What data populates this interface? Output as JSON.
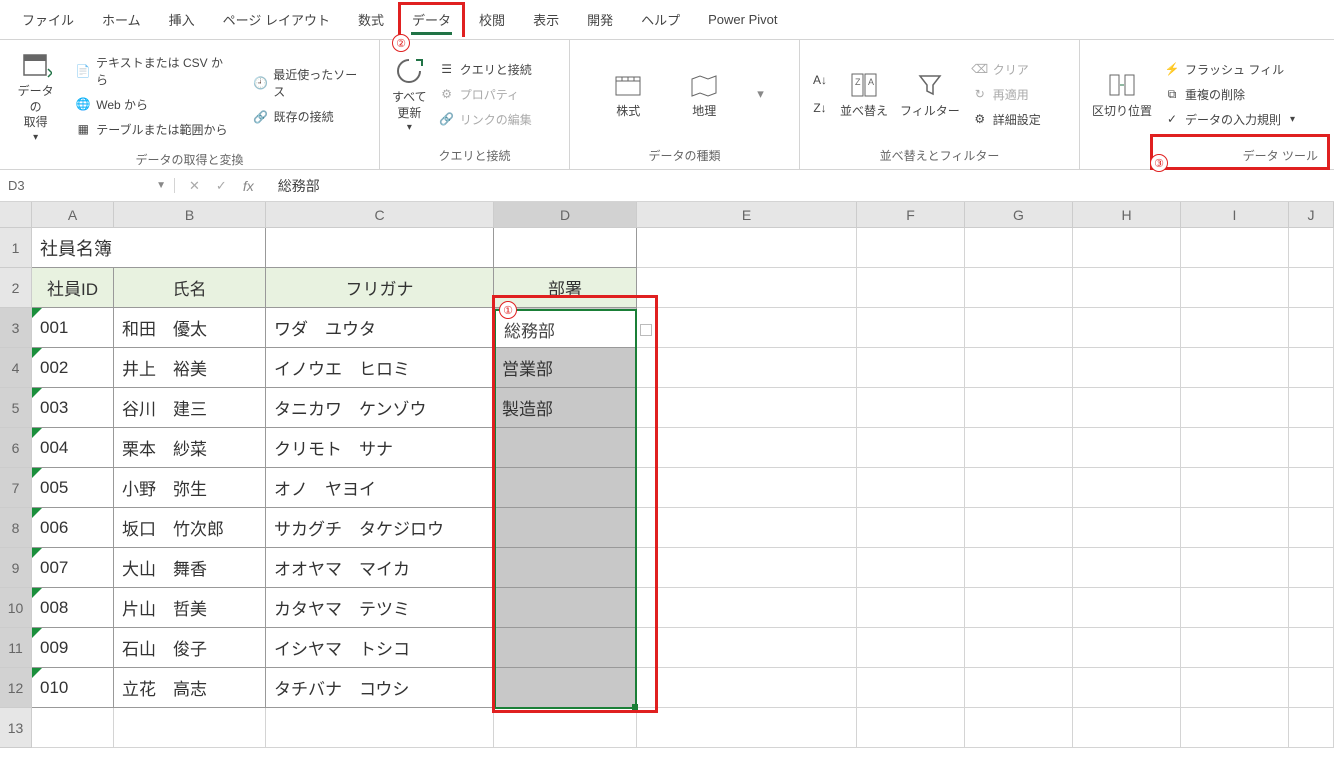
{
  "tabs": [
    "ファイル",
    "ホーム",
    "挿入",
    "ページ レイアウト",
    "数式",
    "データ",
    "校閲",
    "表示",
    "開発",
    "ヘルプ",
    "Power Pivot"
  ],
  "active_tab": "データ",
  "ribbon": {
    "g1": {
      "label": "データの取得と変換",
      "big": "データの\n取得",
      "items": [
        "テキストまたは CSV から",
        "Web から",
        "テーブルまたは範囲から",
        "最近使ったソース",
        "既存の接続"
      ]
    },
    "g2": {
      "label": "クエリと接続",
      "big": "すべて\n更新",
      "items": [
        "クエリと接続",
        "プロパティ",
        "リンクの編集"
      ]
    },
    "g3": {
      "label": "データの種類",
      "items": [
        "株式",
        "地理"
      ]
    },
    "g4": {
      "label": "並べ替えとフィルター",
      "sort": "並べ替え",
      "filter": "フィルター",
      "items": [
        "クリア",
        "再適用",
        "詳細設定"
      ]
    },
    "g5": {
      "label": "データ ツール",
      "big": "区切り位置",
      "items": [
        "フラッシュ フィル",
        "重複の削除",
        "データの入力規則"
      ]
    }
  },
  "name_box": "D3",
  "formula_value": "総務部",
  "columns": [
    "A",
    "B",
    "C",
    "D",
    "E",
    "F",
    "G",
    "H",
    "I",
    "J"
  ],
  "title_cell": "社員名簿",
  "headers": [
    "社員ID",
    "氏名",
    "フリガナ",
    "部署"
  ],
  "rows": [
    {
      "id": "001",
      "name": "和田　優太",
      "kana": "ワダ　ユウタ",
      "dept": "総務部"
    },
    {
      "id": "002",
      "name": "井上　裕美",
      "kana": "イノウエ　ヒロミ",
      "dept": "営業部"
    },
    {
      "id": "003",
      "name": "谷川　建三",
      "kana": "タニカワ　ケンゾウ",
      "dept": "製造部"
    },
    {
      "id": "004",
      "name": "栗本　紗菜",
      "kana": "クリモト　サナ",
      "dept": ""
    },
    {
      "id": "005",
      "name": "小野　弥生",
      "kana": "オノ　ヤヨイ",
      "dept": ""
    },
    {
      "id": "006",
      "name": "坂口　竹次郎",
      "kana": "サカグチ　タケジロウ",
      "dept": ""
    },
    {
      "id": "007",
      "name": "大山　舞香",
      "kana": "オオヤマ　マイカ",
      "dept": ""
    },
    {
      "id": "008",
      "name": "片山　哲美",
      "kana": "カタヤマ　テツミ",
      "dept": ""
    },
    {
      "id": "009",
      "name": "石山　俊子",
      "kana": "イシヤマ　トシコ",
      "dept": ""
    },
    {
      "id": "010",
      "name": "立花　高志",
      "kana": "タチバナ　コウシ",
      "dept": ""
    }
  ],
  "annotations": {
    "a1": "①",
    "a2": "②",
    "a3": "③"
  }
}
